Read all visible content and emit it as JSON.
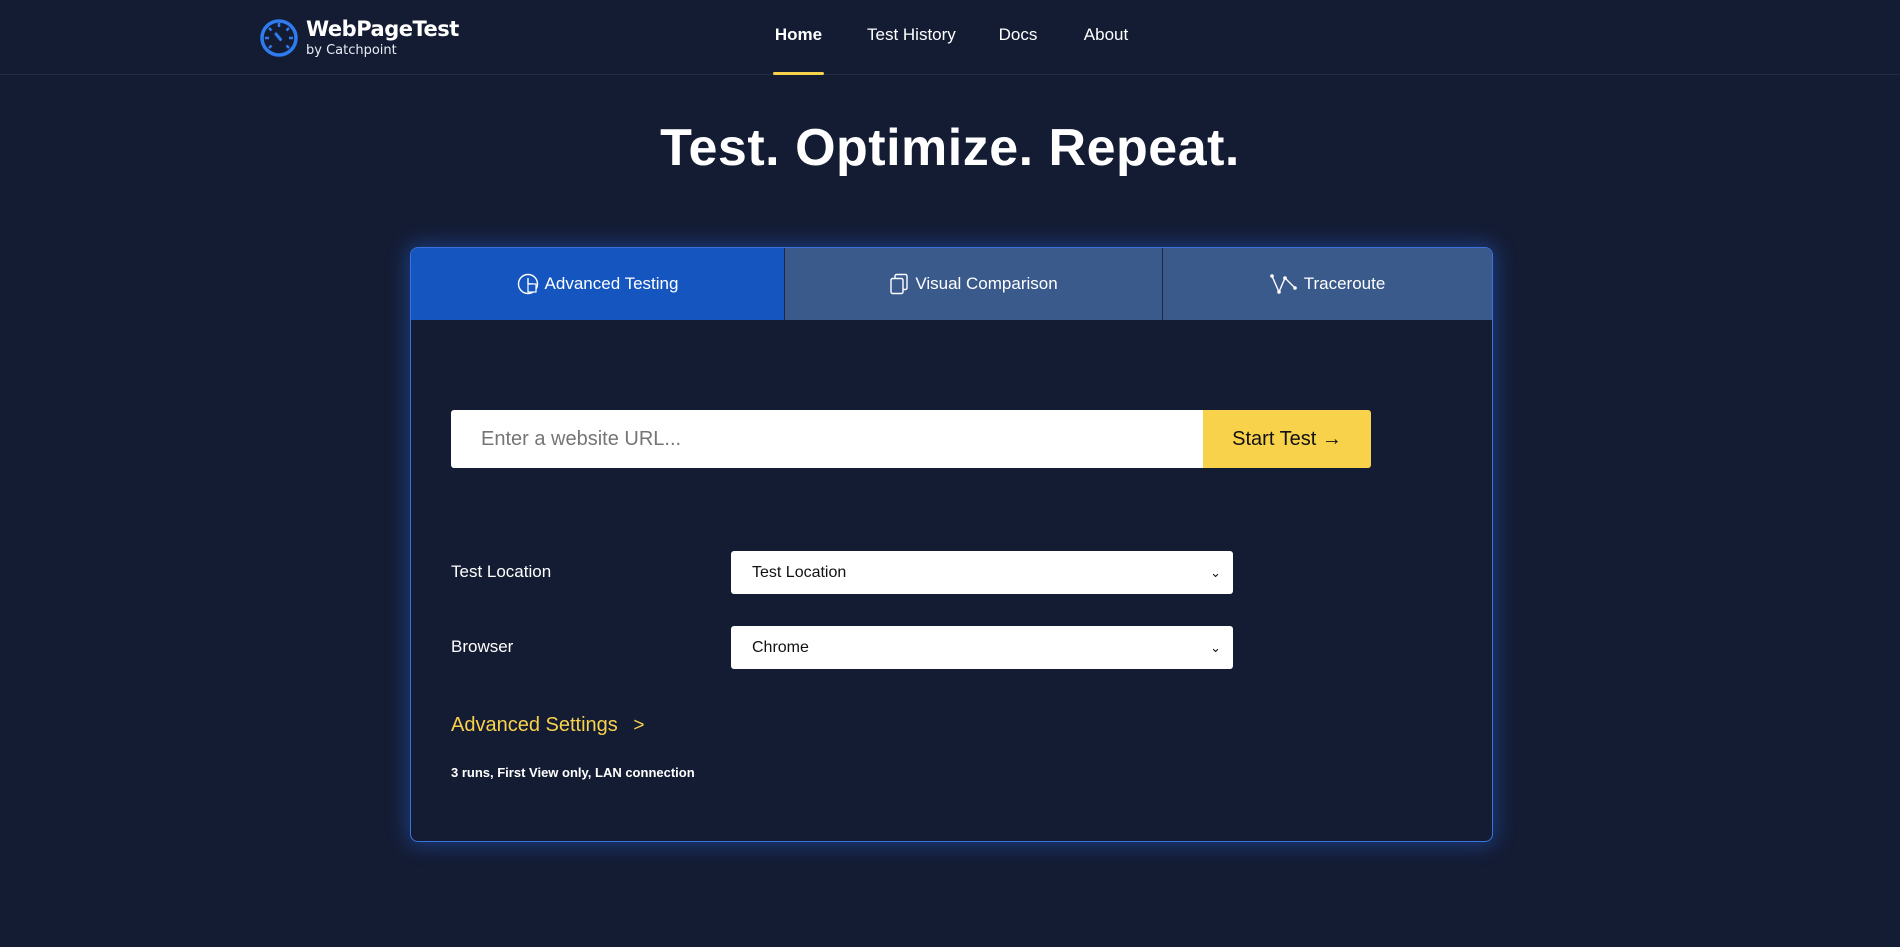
{
  "header": {
    "logo_name": "WebPageTest",
    "logo_sub": "by Catchpoint",
    "nav": [
      {
        "label": "Home",
        "active": true
      },
      {
        "label": "Test History",
        "active": false
      },
      {
        "label": "Docs",
        "active": false
      },
      {
        "label": "About",
        "active": false
      }
    ]
  },
  "hero": {
    "title": "Test. Optimize. Repeat."
  },
  "tabs": [
    {
      "label": "Advanced Testing",
      "icon": "gauge-icon",
      "active": true
    },
    {
      "label": "Visual Comparison",
      "icon": "copy-icon",
      "active": false
    },
    {
      "label": "Traceroute",
      "icon": "route-icon",
      "active": false
    }
  ],
  "form": {
    "url_placeholder": "Enter a website URL...",
    "start_label": "Start Test →",
    "location_label": "Test Location",
    "location_value": "Test Location",
    "browser_label": "Browser",
    "browser_value": "Chrome",
    "advanced_label": "Advanced Settings",
    "advanced_arrow": ">",
    "summary": "3 runs, First View only, LAN connection"
  },
  "colors": {
    "background": "#141c33",
    "accent": "#f8d24b",
    "tab_active": "#1455c0",
    "tab_inactive": "#3b5a8c",
    "brand_blue": "#2f7bf0"
  }
}
